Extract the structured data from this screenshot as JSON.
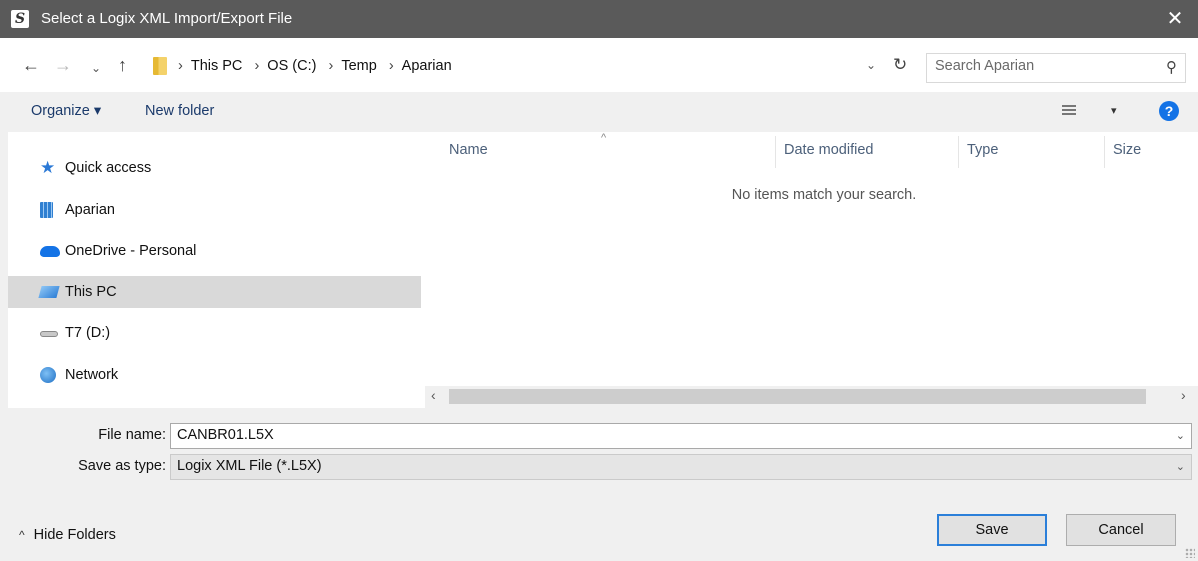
{
  "window": {
    "title": "Select a Logix XML Import/Export File",
    "app_icon_glyph": "S",
    "close_glyph": "✕"
  },
  "nav": {
    "back": "←",
    "forward": "→",
    "recent": "⌄",
    "up": "↑"
  },
  "address": {
    "crumbs": [
      "This PC",
      "OS (C:)",
      "Temp",
      "Aparian"
    ],
    "separator": "›",
    "dropdown": "⌄",
    "refresh": "↻"
  },
  "search": {
    "placeholder": "Search Aparian",
    "icon": "⚲"
  },
  "toolbar": {
    "organize": "Organize ▾",
    "new_folder": "New folder",
    "view_dropdown": "▾",
    "help": "?"
  },
  "sidebar": {
    "items": [
      {
        "label": "Quick access",
        "icon": "star-icon"
      },
      {
        "label": "Aparian",
        "icon": "building-icon"
      },
      {
        "label": "OneDrive - Personal",
        "icon": "cloud-icon"
      },
      {
        "label": "This PC",
        "icon": "computer-icon",
        "selected": true
      },
      {
        "label": "T7 (D:)",
        "icon": "drive-icon"
      },
      {
        "label": "Network",
        "icon": "network-icon"
      }
    ]
  },
  "files": {
    "columns": [
      "Name",
      "Date modified",
      "Type",
      "Size"
    ],
    "sort_indicator": "^",
    "empty_message": "No items match your search.",
    "scroll_left": "‹",
    "scroll_right": "›"
  },
  "form": {
    "file_name_label": "File name:",
    "file_name_value": "CANBR01.L5X",
    "save_type_label": "Save as type:",
    "save_type_value": "Logix XML File (*.L5X)",
    "chevron": "⌄"
  },
  "footer": {
    "hide_folders": "Hide Folders",
    "hide_glyph": "^",
    "save": "Save",
    "cancel": "Cancel"
  },
  "colors": {
    "titlebar": "#5a5a5a",
    "accent": "#2b7fd9",
    "selected_row": "#d9d9d9",
    "link": "#1b3a6b"
  }
}
